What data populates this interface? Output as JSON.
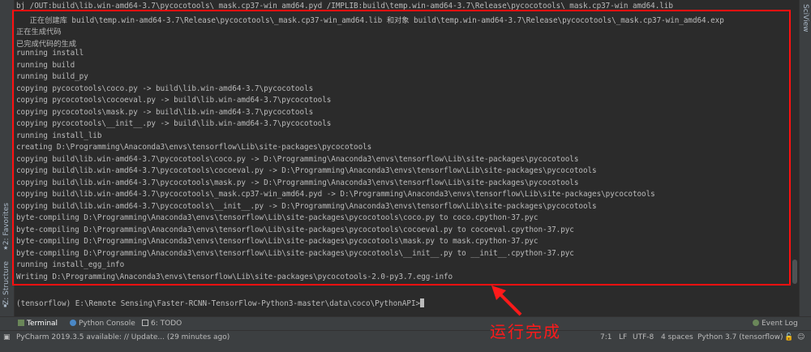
{
  "left_tabs": {
    "structure": "Z: Structure",
    "favorites": "2: Favorites"
  },
  "right_tabs": {
    "sciview": "SciView"
  },
  "terminal": {
    "lines": [
      "bj /OUT:build\\lib.win-amd64-3.7\\pycocotools\\_mask.cp37-win_amd64.pyd /IMPLIB:build\\temp.win-amd64-3.7\\Release\\pycocotools\\_mask.cp37-win_amd64.lib",
      "   正在创建库 build\\temp.win-amd64-3.7\\Release\\pycocotools\\_mask.cp37-win_amd64.lib 和对象 build\\temp.win-amd64-3.7\\Release\\pycocotools\\_mask.cp37-win_amd64.exp",
      "正在生成代码",
      "已完成代码的生成",
      "running install",
      "running build",
      "running build_py",
      "copying pycocotools\\coco.py -> build\\lib.win-amd64-3.7\\pycocotools",
      "copying pycocotools\\cocoeval.py -> build\\lib.win-amd64-3.7\\pycocotools",
      "copying pycocotools\\mask.py -> build\\lib.win-amd64-3.7\\pycocotools",
      "copying pycocotools\\__init__.py -> build\\lib.win-amd64-3.7\\pycocotools",
      "running install_lib",
      "creating D:\\Programming\\Anaconda3\\envs\\tensorflow\\Lib\\site-packages\\pycocotools",
      "copying build\\lib.win-amd64-3.7\\pycocotools\\coco.py -> D:\\Programming\\Anaconda3\\envs\\tensorflow\\Lib\\site-packages\\pycocotools",
      "copying build\\lib.win-amd64-3.7\\pycocotools\\cocoeval.py -> D:\\Programming\\Anaconda3\\envs\\tensorflow\\Lib\\site-packages\\pycocotools",
      "copying build\\lib.win-amd64-3.7\\pycocotools\\mask.py -> D:\\Programming\\Anaconda3\\envs\\tensorflow\\Lib\\site-packages\\pycocotools",
      "copying build\\lib.win-amd64-3.7\\pycocotools\\_mask.cp37-win_amd64.pyd -> D:\\Programming\\Anaconda3\\envs\\tensorflow\\Lib\\site-packages\\pycocotools",
      "copying build\\lib.win-amd64-3.7\\pycocotools\\__init__.py -> D:\\Programming\\Anaconda3\\envs\\tensorflow\\Lib\\site-packages\\pycocotools",
      "byte-compiling D:\\Programming\\Anaconda3\\envs\\tensorflow\\Lib\\site-packages\\pycocotools\\coco.py to coco.cpython-37.pyc",
      "byte-compiling D:\\Programming\\Anaconda3\\envs\\tensorflow\\Lib\\site-packages\\pycocotools\\cocoeval.py to cocoeval.cpython-37.pyc",
      "byte-compiling D:\\Programming\\Anaconda3\\envs\\tensorflow\\Lib\\site-packages\\pycocotools\\mask.py to mask.cpython-37.pyc",
      "byte-compiling D:\\Programming\\Anaconda3\\envs\\tensorflow\\Lib\\site-packages\\pycocotools\\__init__.py to __init__.cpython-37.pyc",
      "running install_egg_info",
      "Writing D:\\Programming\\Anaconda3\\envs\\tensorflow\\Lib\\site-packages\\pycocotools-2.0-py3.7.egg-info"
    ],
    "prompt": "(tensorflow) E:\\Remote Sensing\\Faster-RCNN-TensorFlow-Python3-master\\data\\coco\\PythonAPI>"
  },
  "annotation": {
    "text": "运行完成",
    "color": "#ff1a1a"
  },
  "toolbar": {
    "terminal": "Terminal",
    "python_console": "Python Console",
    "todo": "6: TODO",
    "event_log": "Event Log"
  },
  "statusbar": {
    "message": "PyCharm 2019.3.5 available: // Update... (29 minutes ago)",
    "position": "7:1",
    "line_sep": "LF",
    "encoding": "UTF-8",
    "indent": "4 spaces",
    "interpreter": "Python 3.7 (tensorflow)"
  },
  "colors": {
    "background": "#2b2b2b",
    "panel": "#3c3f41",
    "text": "#bbbbbb",
    "highlight": "#ff1010"
  }
}
